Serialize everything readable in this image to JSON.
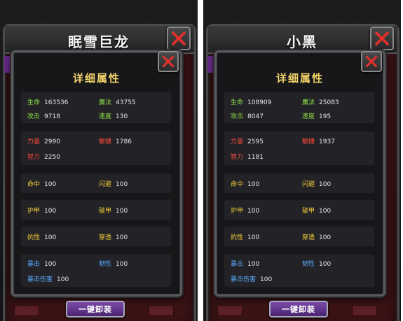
{
  "panels": [
    {
      "name": "眠雪巨龙",
      "dialog_title": "详细属性",
      "equip_button": "一键卸装",
      "stats": {
        "hp": {
          "label": "生命",
          "value": "163536"
        },
        "mp": {
          "label": "魔法",
          "value": "43755"
        },
        "atk": {
          "label": "攻击",
          "value": "9718"
        },
        "spd": {
          "label": "速度",
          "value": "130"
        },
        "str": {
          "label": "力量",
          "value": "2990"
        },
        "agi": {
          "label": "敏捷",
          "value": "1786"
        },
        "int": {
          "label": "智力",
          "value": "2250"
        },
        "hit": {
          "label": "命中",
          "value": "100"
        },
        "dodge": {
          "label": "闪避",
          "value": "100"
        },
        "armor": {
          "label": "护甲",
          "value": "100"
        },
        "armor_pen": {
          "label": "破甲",
          "value": "100"
        },
        "resist": {
          "label": "抗性",
          "value": "100"
        },
        "penetrate": {
          "label": "穿透",
          "value": "100"
        },
        "crit": {
          "label": "暴击",
          "value": "100"
        },
        "tenacity": {
          "label": "韧性",
          "value": "100"
        },
        "crit_dmg": {
          "label": "暴击伤害",
          "value": "100"
        }
      }
    },
    {
      "name": "小黑",
      "dialog_title": "详细属性",
      "equip_button": "一键卸装",
      "stats": {
        "hp": {
          "label": "生命",
          "value": "108909"
        },
        "mp": {
          "label": "魔法",
          "value": "25083"
        },
        "atk": {
          "label": "攻击",
          "value": "8047"
        },
        "spd": {
          "label": "速度",
          "value": "195"
        },
        "str": {
          "label": "力量",
          "value": "2595"
        },
        "agi": {
          "label": "敏捷",
          "value": "1937"
        },
        "int": {
          "label": "智力",
          "value": "1181"
        },
        "hit": {
          "label": "命中",
          "value": "100"
        },
        "dodge": {
          "label": "闪避",
          "value": "100"
        },
        "armor": {
          "label": "护甲",
          "value": "100"
        },
        "armor_pen": {
          "label": "破甲",
          "value": "100"
        },
        "resist": {
          "label": "抗性",
          "value": "100"
        },
        "penetrate": {
          "label": "穿透",
          "value": "100"
        },
        "crit": {
          "label": "暴击",
          "value": "100"
        },
        "tenacity": {
          "label": "韧性",
          "value": "100"
        },
        "crit_dmg": {
          "label": "暴击伤害",
          "value": "100"
        }
      }
    }
  ],
  "icons": {
    "close": "close-x-icon"
  },
  "colors": {
    "title_gold": "#f3d46a",
    "basic_green": "#8ee04a",
    "attribute_red": "#ff4a3a",
    "defense_yellow": "#f2cc3a",
    "crit_blue": "#5aa8ff",
    "close_red": "#e8302a",
    "button_purple": "#6a3a98"
  }
}
